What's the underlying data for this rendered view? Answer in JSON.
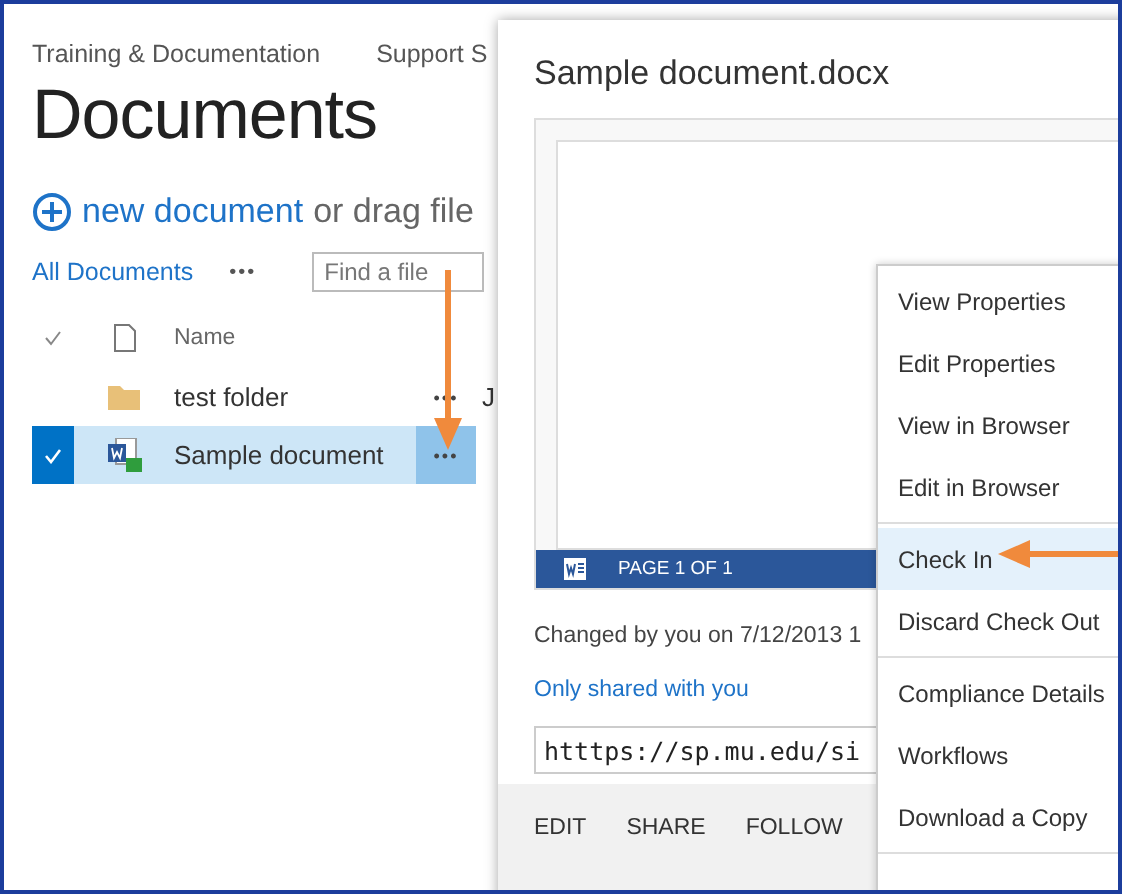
{
  "breadcrumb": [
    "Training & Documentation",
    "Support S"
  ],
  "title": "Documents",
  "new_document": {
    "link": "new document",
    "rest": "or drag file"
  },
  "toolbar": {
    "view": "All Documents",
    "more": "•••",
    "search": {
      "placeholder": "Find a file"
    }
  },
  "columns": {
    "name": "Name"
  },
  "rows": [
    {
      "name": "test folder",
      "kind": "folder",
      "selected": false,
      "more": "•••",
      "column_3": "J"
    },
    {
      "name": "Sample document",
      "kind": "word",
      "selected": true,
      "more": "•••"
    }
  ],
  "callout": {
    "title": "Sample document.docx",
    "page_label": "PAGE 1 OF 1",
    "changed": "Changed by you on 7/12/2013 1",
    "sharing": "Only shared with you",
    "url": "htttps://sp.mu.edu/si",
    "actions": [
      "EDIT",
      "SHARE",
      "FOLLOW"
    ]
  },
  "menu": [
    [
      {
        "label": "View Properties",
        "selected": false
      },
      {
        "label": "Edit Properties",
        "selected": false
      },
      {
        "label": "View in Browser",
        "selected": false
      },
      {
        "label": "Edit in Browser",
        "selected": false
      }
    ],
    [
      {
        "label": "Check In",
        "selected": true
      },
      {
        "label": "Discard Check Out",
        "selected": false
      }
    ],
    [
      {
        "label": "Compliance Details",
        "selected": false
      },
      {
        "label": "Workflows",
        "selected": false
      },
      {
        "label": "Download a Copy",
        "selected": false
      }
    ]
  ]
}
